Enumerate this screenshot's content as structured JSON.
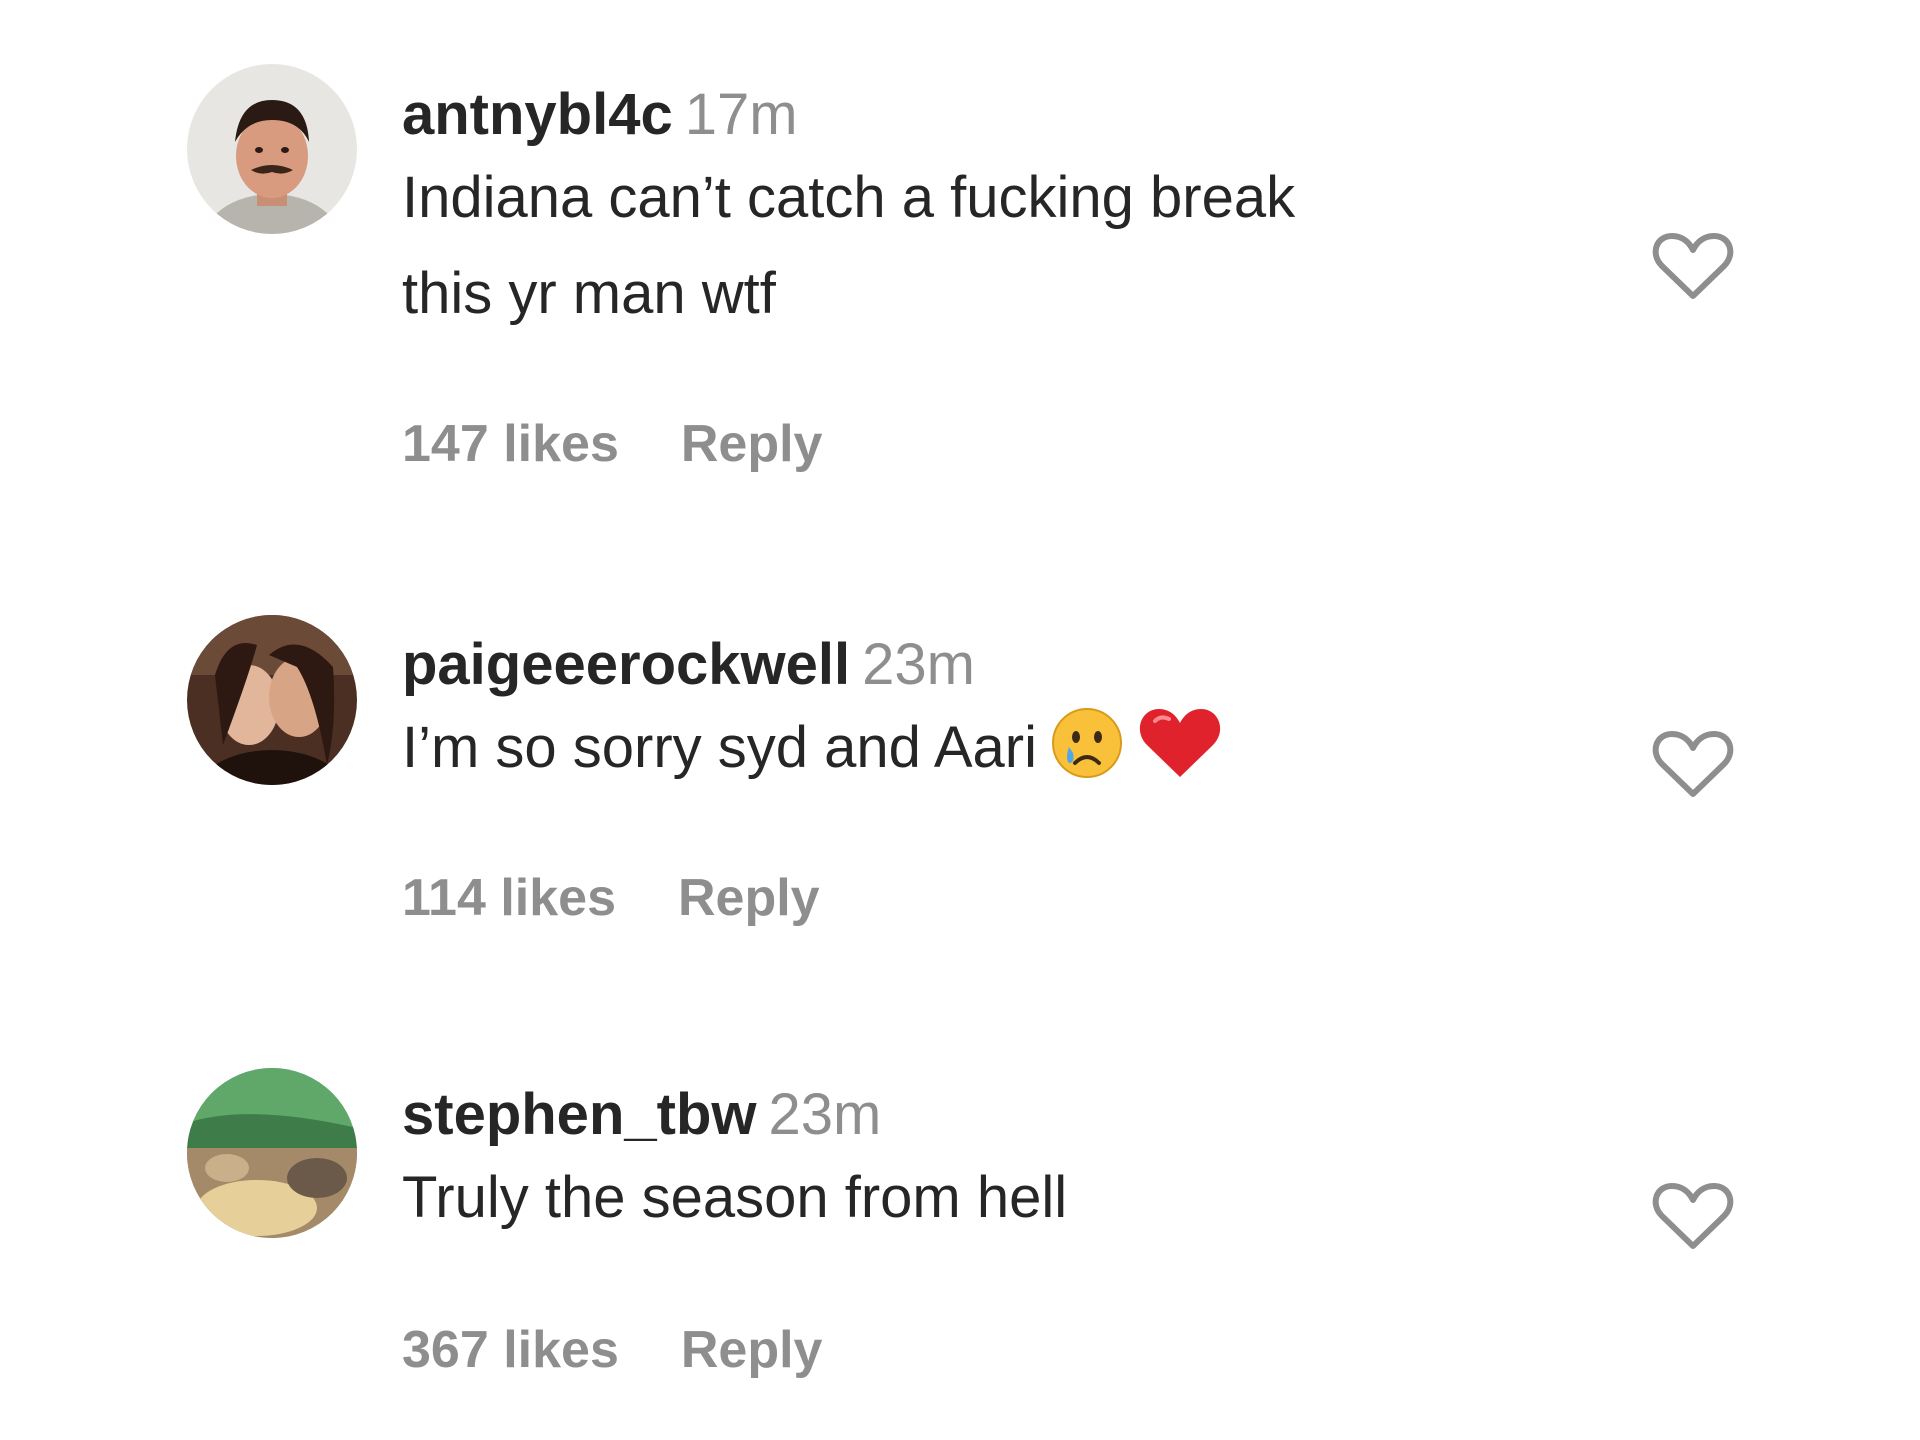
{
  "comments": [
    {
      "username": "antnybl4c",
      "time": "17m",
      "text_lines": [
        "Indiana can’t catch a fucking break",
        "this yr man wtf"
      ],
      "likes": "147 likes",
      "reply": "Reply"
    },
    {
      "username": "paigeeerockwell",
      "time": "23m",
      "text_lines": [
        "I’m so sorry syd and Aari"
      ],
      "emojis": [
        "crying-face-emoji",
        "red-heart-emoji"
      ],
      "likes": "114 likes",
      "reply": "Reply"
    },
    {
      "username": "stephen_tbw",
      "time": "23m",
      "text_lines": [
        "Truly the season from hell"
      ],
      "likes": "367 likes",
      "reply": "Reply"
    }
  ],
  "colors": {
    "primary_text": "#262626",
    "secondary_text": "#8e8e8e"
  },
  "icons": {
    "like": "heart-outline-icon"
  }
}
